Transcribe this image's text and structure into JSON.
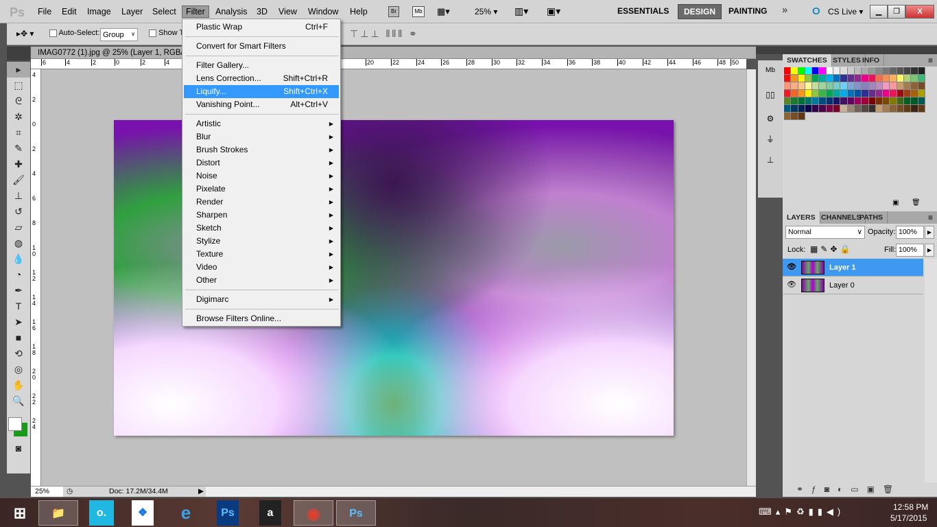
{
  "app": {
    "logo": "Ps"
  },
  "menubar": {
    "items": [
      "File",
      "Edit",
      "Image",
      "Layer",
      "Select",
      "Filter",
      "Analysis",
      "3D",
      "View",
      "Window",
      "Help"
    ],
    "active": "Filter",
    "bridge": "Br",
    "minibridge": "Mb",
    "zoom": "25%",
    "workspaces": [
      "ESSENTIALS",
      "DESIGN",
      "PAINTING"
    ],
    "active_workspace": "DESIGN",
    "more": "»",
    "cslive": "CS Live"
  },
  "options": {
    "auto_select_label": "Auto-Select:",
    "auto_select_value": "Group",
    "show_transform_label": "Show T"
  },
  "document": {
    "tab_title": "IMAG0772 (1).jpg @ 25% (Layer 1, RGB/8"
  },
  "rulers": {
    "h": [
      "6",
      "4",
      "2",
      "0",
      "2",
      "4",
      "20",
      "22",
      "24",
      "26",
      "28",
      "30",
      "32",
      "34",
      "36",
      "38",
      "40",
      "42",
      "44",
      "46",
      "48",
      "50"
    ],
    "v": [
      "4",
      "2",
      "0",
      "2",
      "4",
      "6",
      "8",
      "1 0",
      "1 2",
      "1 4",
      "1 6",
      "1 8",
      "2 0",
      "2 2",
      "2 4"
    ]
  },
  "filter_menu": {
    "items": [
      {
        "label": "Plastic Wrap",
        "shortcut": "Ctrl+F"
      },
      {
        "sep": true
      },
      {
        "label": "Convert for Smart Filters"
      },
      {
        "sep": true
      },
      {
        "label": "Filter Gallery..."
      },
      {
        "label": "Lens Correction...",
        "shortcut": "Shift+Ctrl+R"
      },
      {
        "label": "Liquify...",
        "shortcut": "Shift+Ctrl+X",
        "highlighted": true
      },
      {
        "label": "Vanishing Point...",
        "shortcut": "Alt+Ctrl+V"
      },
      {
        "sep": true
      },
      {
        "label": "Artistic",
        "submenu": true
      },
      {
        "label": "Blur",
        "submenu": true
      },
      {
        "label": "Brush Strokes",
        "submenu": true
      },
      {
        "label": "Distort",
        "submenu": true
      },
      {
        "label": "Noise",
        "submenu": true
      },
      {
        "label": "Pixelate",
        "submenu": true
      },
      {
        "label": "Render",
        "submenu": true
      },
      {
        "label": "Sharpen",
        "submenu": true
      },
      {
        "label": "Sketch",
        "submenu": true
      },
      {
        "label": "Stylize",
        "submenu": true
      },
      {
        "label": "Texture",
        "submenu": true
      },
      {
        "label": "Video",
        "submenu": true
      },
      {
        "label": "Other",
        "submenu": true
      },
      {
        "sep": true
      },
      {
        "label": "Digimarc",
        "submenu": true
      },
      {
        "sep": true
      },
      {
        "label": "Browse Filters Online..."
      }
    ]
  },
  "status": {
    "zoom": "25%",
    "doc": "Doc: 17.2M/34.4M"
  },
  "swatch_panel": {
    "tabs": [
      "SWATCHES",
      "STYLES",
      "INFO"
    ],
    "colors": [
      "#ff0000",
      "#ffff00",
      "#00ff00",
      "#00ffff",
      "#0000ff",
      "#ff00ff",
      "#ffffff",
      "#eeeeee",
      "#dddddd",
      "#cccccc",
      "#bbbbbb",
      "#aaaaaa",
      "#999999",
      "#888888",
      "#777777",
      "#666666",
      "#555555",
      "#444444",
      "#333333",
      "#222222",
      "#f01010",
      "#f7941d",
      "#fff200",
      "#8dc63f",
      "#00a651",
      "#00a99d",
      "#00aeef",
      "#0072bc",
      "#2e3192",
      "#662d91",
      "#92278f",
      "#ec008c",
      "#ed145b",
      "#f26c4f",
      "#f68e56",
      "#fbaf5d",
      "#fff568",
      "#acd373",
      "#7cc576",
      "#3bb878",
      "#f7977a",
      "#f9ad81",
      "#fdc68a",
      "#fff79a",
      "#c4df9b",
      "#a3d39c",
      "#82ca9d",
      "#7bcdc8",
      "#6ecff6",
      "#7ea7d8",
      "#8493ca",
      "#8882be",
      "#a187be",
      "#bc8dbf",
      "#f49ac2",
      "#f6989d",
      "#c69c6d",
      "#a67c52",
      "#8c6239",
      "#754c24",
      "#ed1c24",
      "#f26522",
      "#f7941d",
      "#fff200",
      "#8dc63f",
      "#39b54a",
      "#00a651",
      "#00a99d",
      "#00aeef",
      "#0072bc",
      "#0054a6",
      "#2e3192",
      "#662d91",
      "#92278f",
      "#ec008c",
      "#ed145b",
      "#9e0b0f",
      "#a0410d",
      "#a36209",
      "#aba000",
      "#598527",
      "#1a7b30",
      "#007236",
      "#00746b",
      "#0076a3",
      "#004b80",
      "#003471",
      "#1b1464",
      "#440e62",
      "#630460",
      "#9e005d",
      "#9e0039",
      "#790000",
      "#7b2e00",
      "#7d4900",
      "#827b00",
      "#406618",
      "#005e20",
      "#005826",
      "#005952",
      "#005b7f",
      "#003663",
      "#002157",
      "#0d004c",
      "#32004b",
      "#4b0049",
      "#7b0046",
      "#7a0026",
      "#c7b299",
      "#998675",
      "#736357",
      "#534741",
      "#37302d",
      "#c69c6d",
      "#a67c52",
      "#8c6239",
      "#754c24",
      "#603913",
      "#3c2415",
      "#603913",
      "#8c6239",
      "#754c24",
      "#603913"
    ]
  },
  "layers_panel": {
    "tabs": [
      "LAYERS",
      "CHANNELS",
      "PATHS"
    ],
    "blend_mode": "Normal",
    "opacity_label": "Opacity:",
    "opacity": "100%",
    "lock_label": "Lock:",
    "fill_label": "Fill:",
    "fill": "100%",
    "layers": [
      {
        "name": "Layer 1",
        "selected": true
      },
      {
        "name": "Layer 0",
        "selected": false
      }
    ]
  },
  "taskbar": {
    "clock_time": "12:58 PM",
    "clock_date": "5/17/2015",
    "apps": [
      "File Explorer",
      "Ooma",
      "Dropbox",
      "Internet Explorer",
      "Photoshop",
      "Amazon",
      "Chrome",
      "Photoshop"
    ]
  }
}
